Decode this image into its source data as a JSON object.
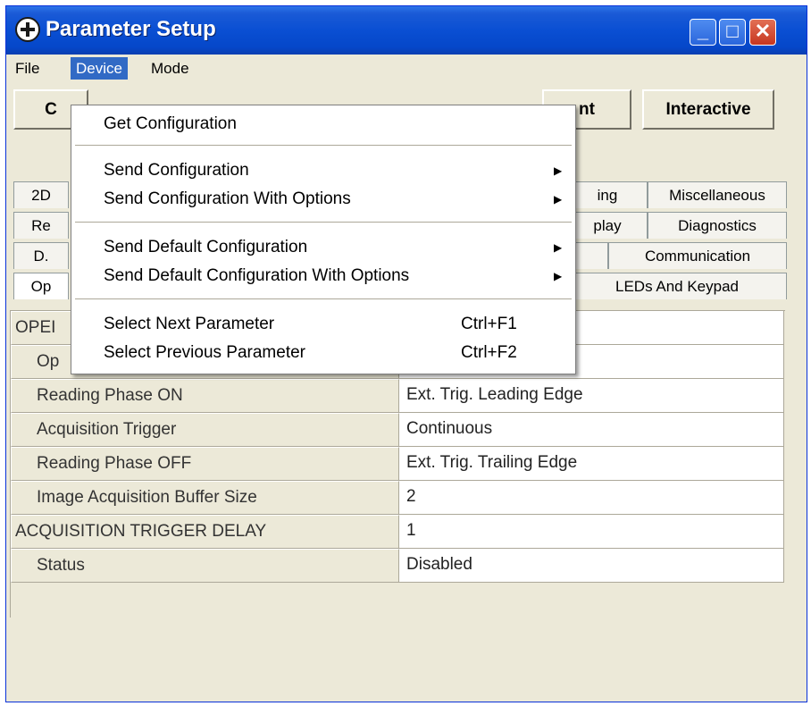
{
  "window": {
    "title": "Parameter Setup",
    "buttons": {
      "minimize": "_",
      "maximize": "□",
      "close": "✕"
    }
  },
  "menubar": {
    "file": "File",
    "device": "Device",
    "mode": "Mode"
  },
  "toolbar": {
    "left_label": "C",
    "middle_label": "nt",
    "interactive_label": "Interactive"
  },
  "tabs": {
    "row1": [
      "2D",
      "ing",
      "Miscellaneous"
    ],
    "row2": [
      "Re",
      "play",
      "Diagnostics"
    ],
    "row3": [
      "D.",
      "",
      "Communication"
    ],
    "row4": [
      "Op",
      "LEDs And Keypad"
    ]
  },
  "grid": {
    "rows": [
      {
        "label": "OPEI",
        "value": ""
      },
      {
        "label": "Op",
        "value": ""
      },
      {
        "label": "Reading Phase ON",
        "value": "Ext. Trig. Leading Edge"
      },
      {
        "label": "Acquisition Trigger",
        "value": "Continuous"
      },
      {
        "label": "Reading Phase OFF",
        "value": "Ext. Trig. Trailing Edge"
      },
      {
        "label": "Image Acquisition Buffer Size",
        "value": "2"
      },
      {
        "label": "ACQUISITION TRIGGER DELAY",
        "value": "1"
      },
      {
        "label": "Status",
        "value": "Disabled"
      }
    ]
  },
  "device_menu": {
    "get_configuration": "Get Configuration",
    "send_configuration": "Send Configuration",
    "send_configuration_with_options": "Send Configuration With Options",
    "send_default_configuration": "Send Default Configuration",
    "send_default_configuration_with_options": "Send Default Configuration With Options",
    "select_next_parameter": "Select Next Parameter",
    "select_next_shortcut": "Ctrl+F1",
    "select_previous_parameter": "Select Previous Parameter",
    "select_previous_shortcut": "Ctrl+F2"
  },
  "colors": {
    "titlebar": "#0a4fd3",
    "menu_highlight": "#316ac5",
    "window_bg": "#ece9d8"
  }
}
